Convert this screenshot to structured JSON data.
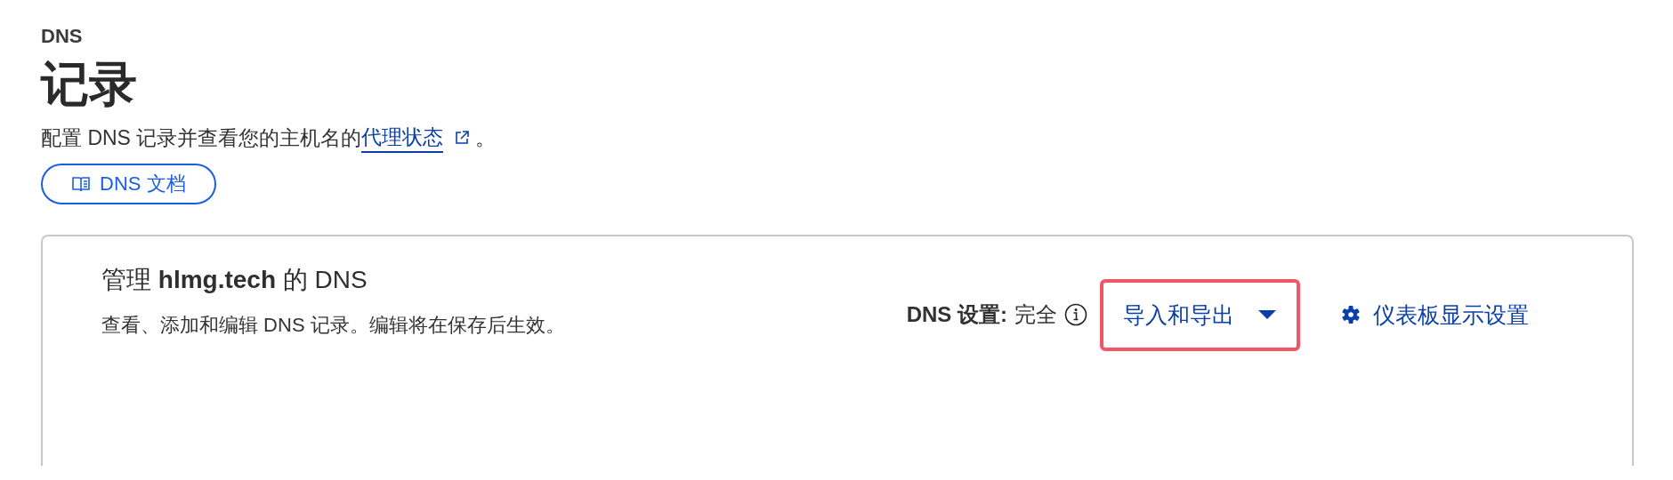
{
  "breadcrumb": "DNS",
  "title": "记录",
  "description": {
    "text": "配置 DNS 记录并查看您的主机名的",
    "link": "代理状态",
    "suffix": "。"
  },
  "docs_button": {
    "label": "DNS 文档"
  },
  "card": {
    "title": "管理 **hlmg.tech** 的 DNS",
    "description": "查看、添加和编辑 DNS 记录。编辑将在保存后生效。",
    "setting": {
      "label": "DNS 设置:",
      "value": "完全"
    },
    "actions": [
      {
        "kind": "dropdown",
        "label": "导入和导出",
        "highlighted": true
      },
      {
        "kind": "settings",
        "label": "仪表板显示设置",
        "highlighted": false
      }
    ]
  }
}
